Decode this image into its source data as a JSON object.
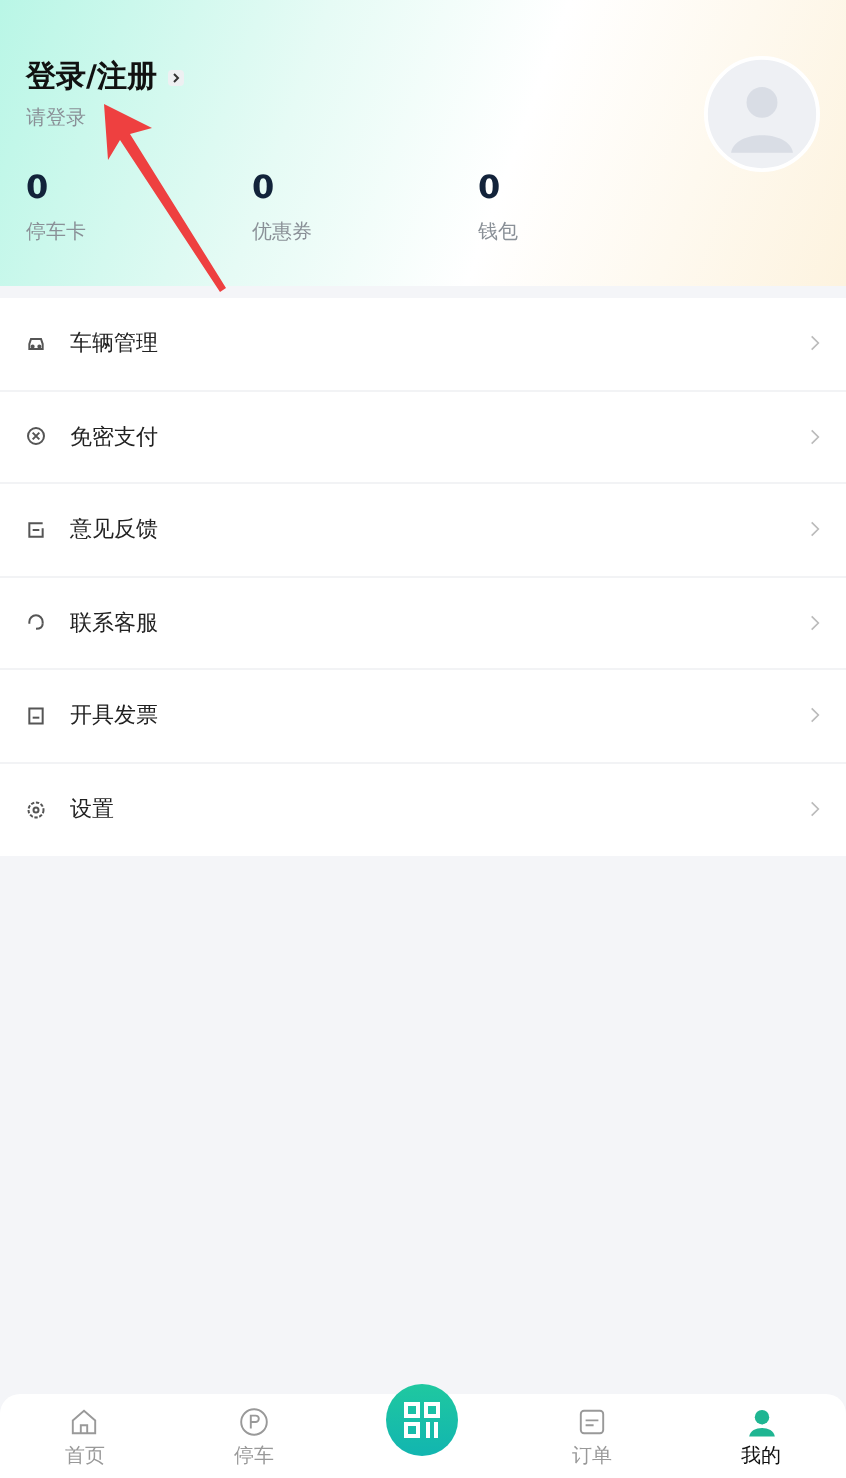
{
  "profile": {
    "title": "登录/注册",
    "subtitle": "请登录"
  },
  "stats": [
    {
      "value": "0",
      "label": "停车卡"
    },
    {
      "value": "0",
      "label": "优惠券"
    },
    {
      "value": "0",
      "label": "钱包"
    }
  ],
  "menu": [
    {
      "label": "车辆管理"
    },
    {
      "label": "免密支付"
    },
    {
      "label": "意见反馈"
    },
    {
      "label": "联系客服"
    },
    {
      "label": "开具发票"
    },
    {
      "label": "设置"
    }
  ],
  "nav": [
    {
      "label": "首页",
      "selected": false
    },
    {
      "label": "停车",
      "selected": false
    },
    {
      "kind": "scan"
    },
    {
      "label": "订单",
      "selected": false
    },
    {
      "label": "我的",
      "selected": true
    }
  ]
}
